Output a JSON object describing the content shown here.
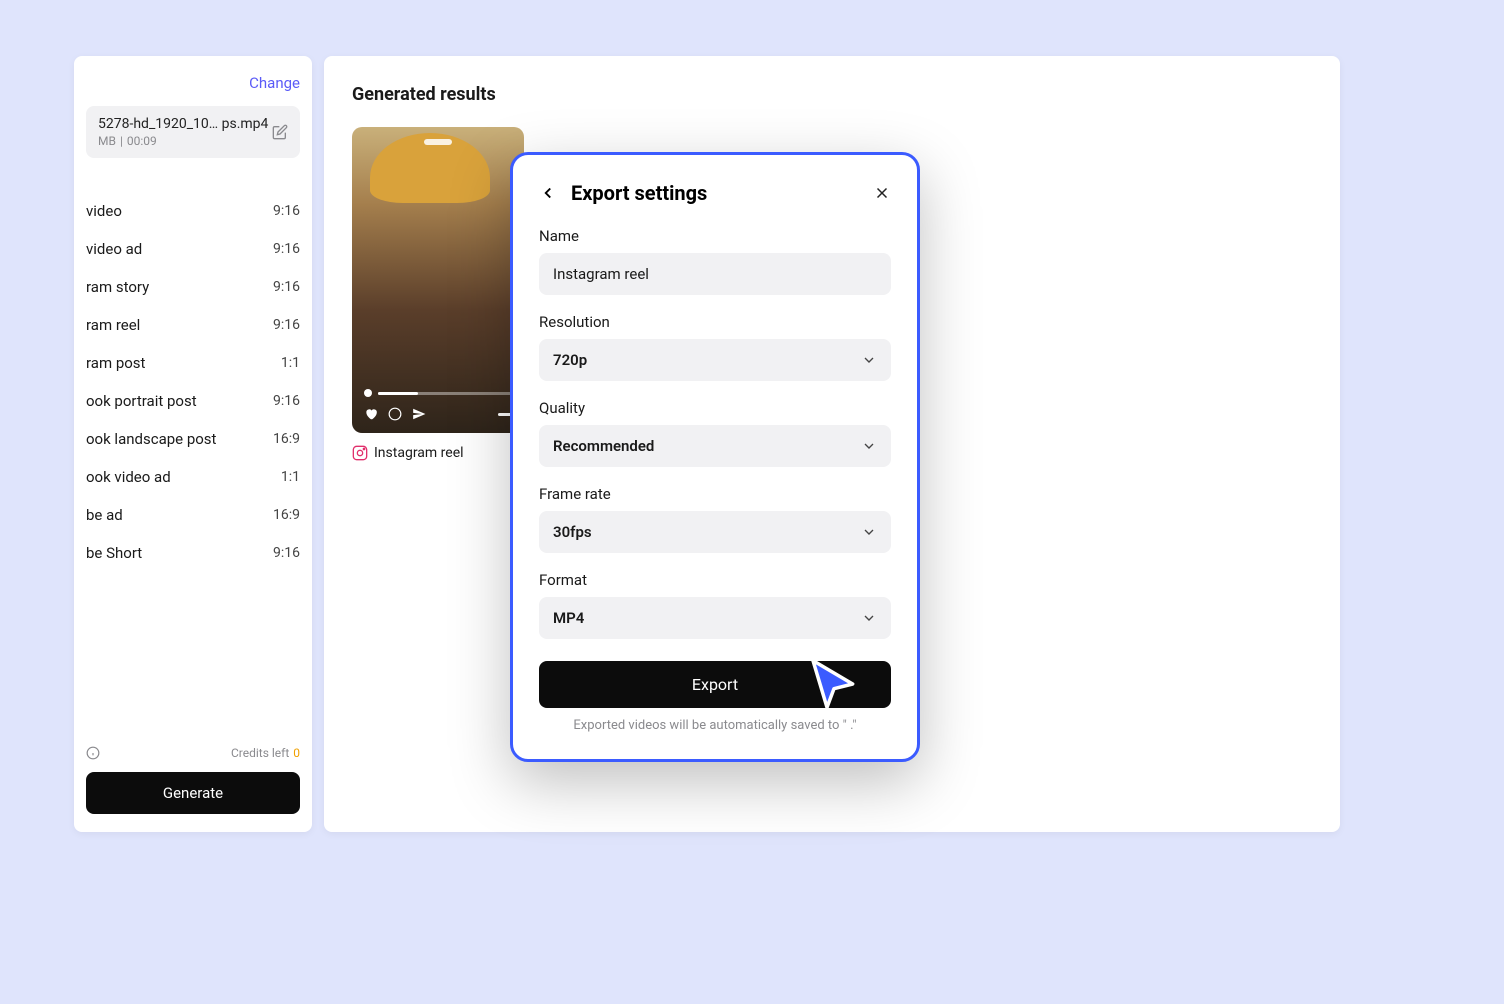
{
  "sidebar": {
    "change_label": "Change",
    "file": {
      "name": "5278-hd_1920_10…  ps.mp4",
      "size": "MB",
      "duration": "00:09"
    },
    "presets": [
      {
        "label": "video",
        "ratio": "9:16"
      },
      {
        "label": "video ad",
        "ratio": "9:16"
      },
      {
        "label": "ram story",
        "ratio": "9:16"
      },
      {
        "label": "ram reel",
        "ratio": "9:16"
      },
      {
        "label": "ram post",
        "ratio": "1:1"
      },
      {
        "label": "ook portrait post",
        "ratio": "9:16"
      },
      {
        "label": "ook landscape post",
        "ratio": "16:9"
      },
      {
        "label": "ook video ad",
        "ratio": "1:1"
      },
      {
        "label": "be ad",
        "ratio": "16:9"
      },
      {
        "label": "be Short",
        "ratio": "9:16"
      }
    ],
    "credits_label": "Credits left",
    "credits_value": "0",
    "generate_label": "Generate"
  },
  "main": {
    "title": "Generated results",
    "result_label": "Instagram reel"
  },
  "modal": {
    "title": "Export settings",
    "name_label": "Name",
    "name_value": "Instagram reel",
    "resolution_label": "Resolution",
    "resolution_value": "720p",
    "quality_label": "Quality",
    "quality_value": "Recommended",
    "framerate_label": "Frame rate",
    "framerate_value": "30fps",
    "format_label": "Format",
    "format_value": "MP4",
    "export_label": "Export",
    "hint": "Exported videos will be automatically saved to \"              .\""
  }
}
